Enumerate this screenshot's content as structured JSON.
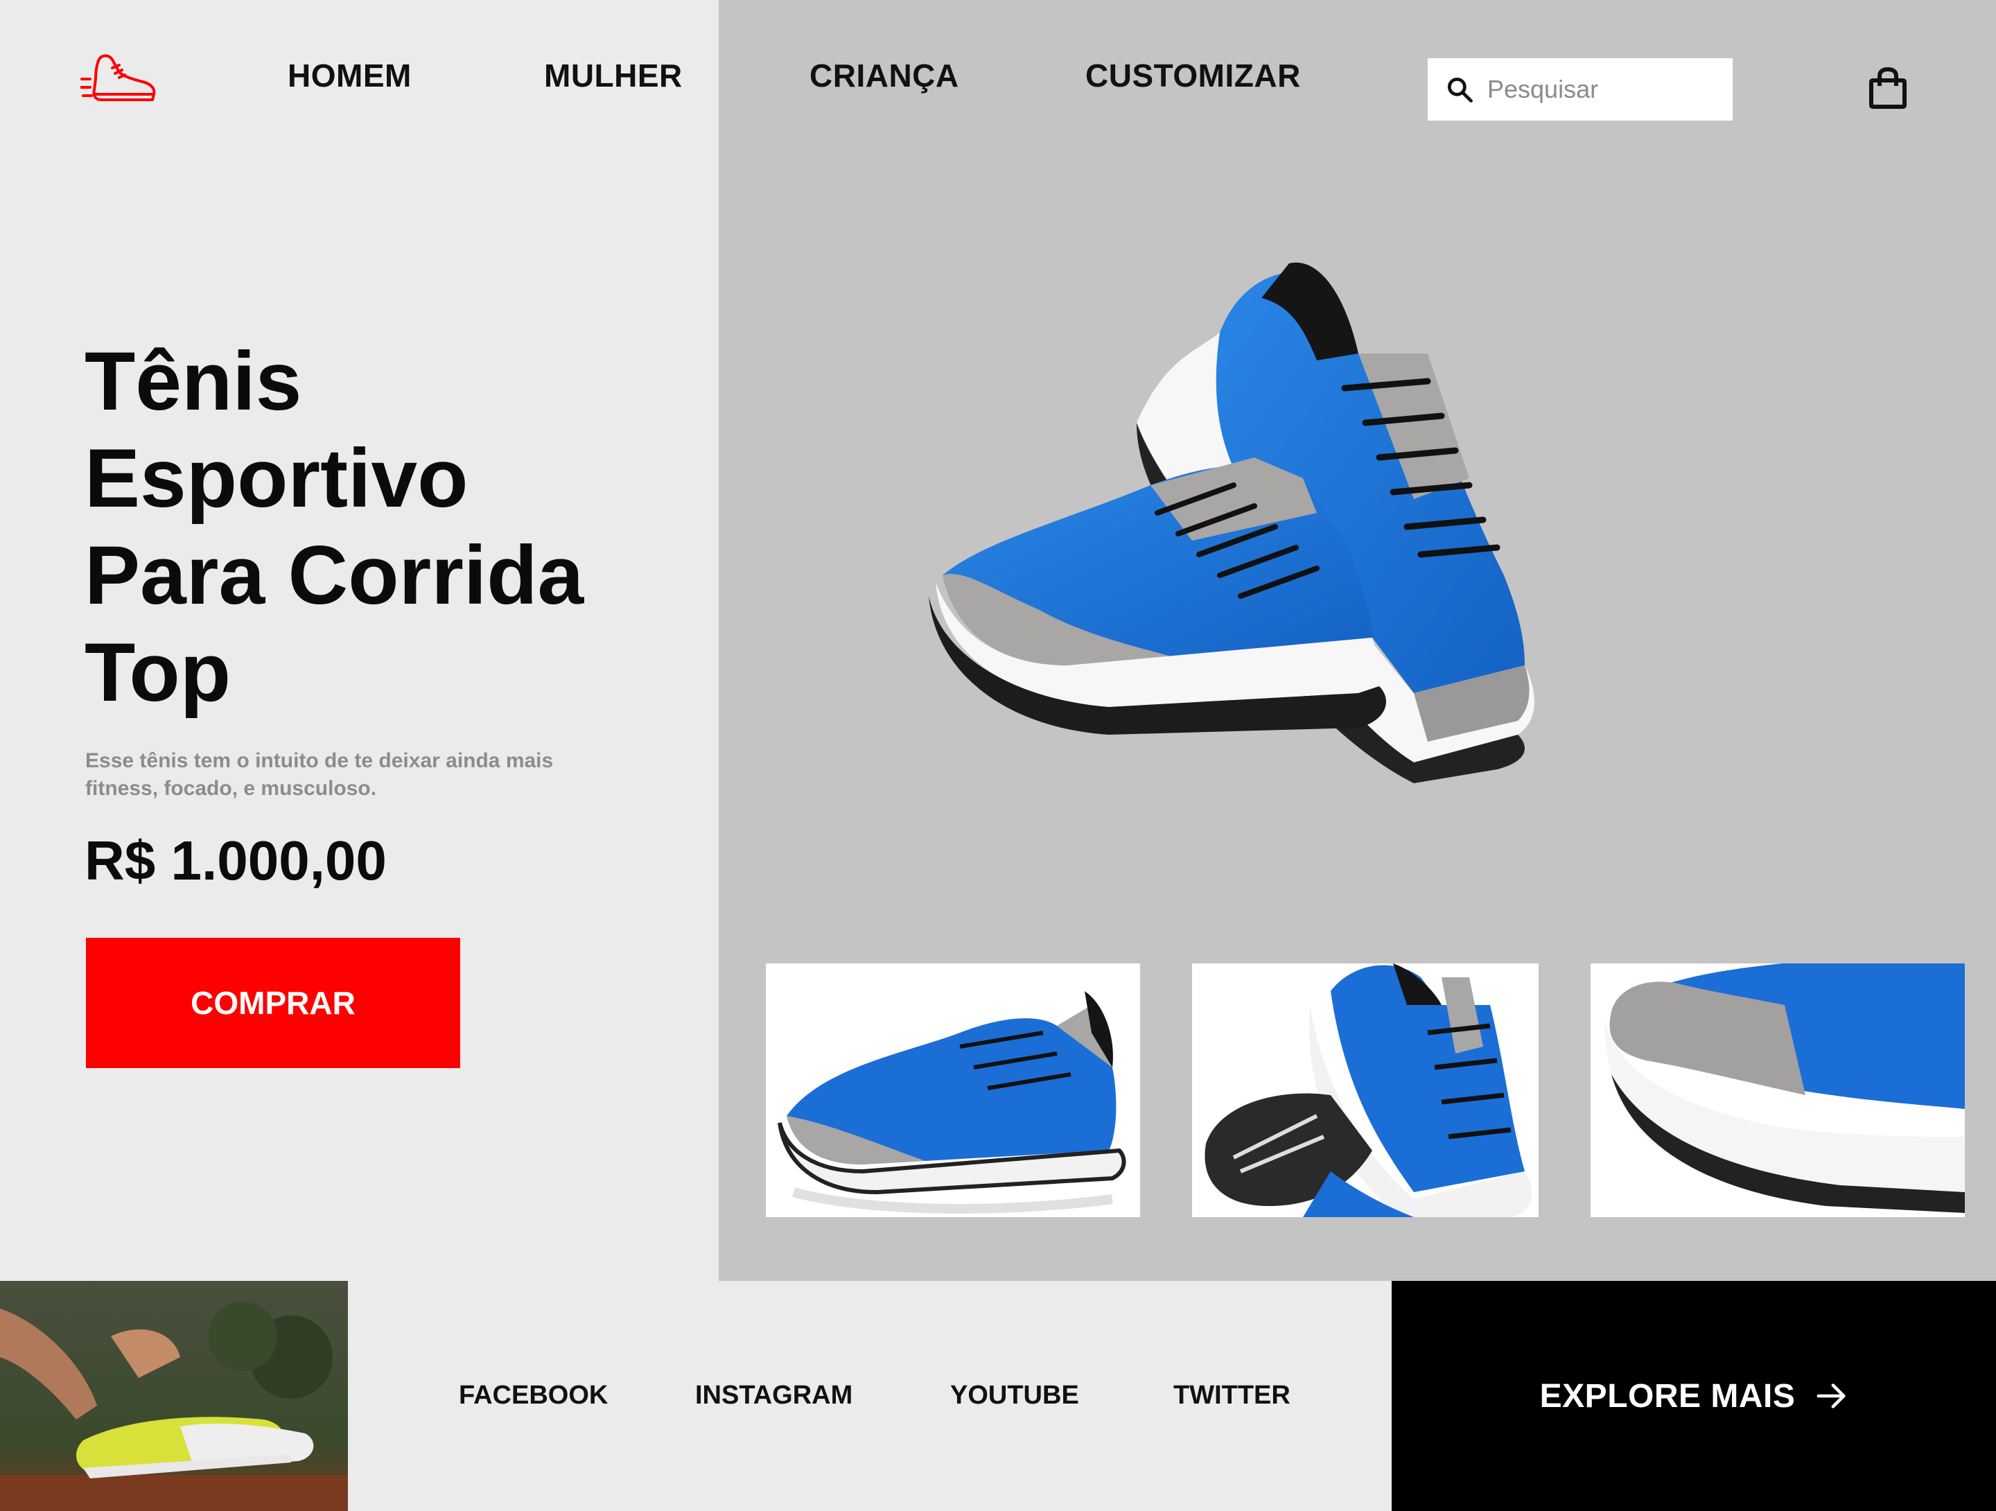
{
  "header": {
    "nav": [
      "HOMEM",
      "MULHER",
      "CRIANÇA",
      "CUSTOMIZAR"
    ],
    "search_placeholder": "Pesquisar"
  },
  "hero": {
    "title_lines": [
      "Tênis",
      "Esportivo",
      "Para Corrida",
      "Top"
    ],
    "description": "Esse tênis tem o intuito de te deixar ainda mais fitness, focado, e musculoso.",
    "price": "R$ 1.000,00",
    "buy_label": "COMPRAR"
  },
  "footer": {
    "social": [
      "FACEBOOK",
      "INSTAGRAM",
      "YOUTUBE",
      "TWITTER"
    ],
    "explore_label": "EXPLORE MAIS"
  },
  "colors": {
    "accent": "#ff0000",
    "shoe_blue": "#1a73d9",
    "left_bg": "#ebebeb",
    "right_bg": "#c4c4c4"
  },
  "icons": [
    "running-shoe-logo-icon",
    "search-icon",
    "shopping-bag-icon",
    "arrow-right-icon"
  ]
}
